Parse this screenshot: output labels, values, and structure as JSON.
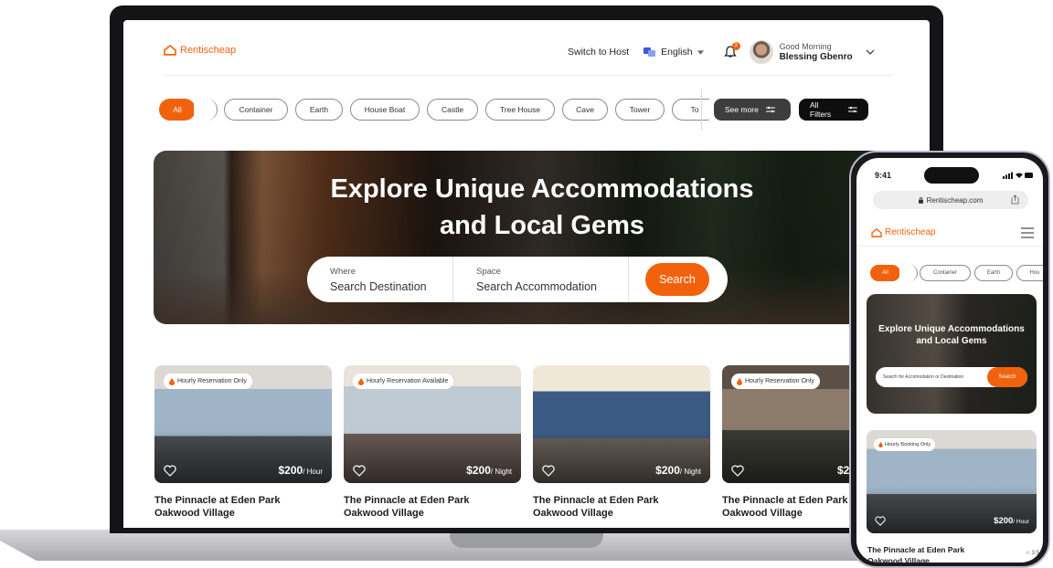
{
  "brand": {
    "name": "Rentischeap",
    "accent": "#f2620d"
  },
  "header": {
    "switch_host": "Switch to Host",
    "language": "English",
    "notification_count": "3",
    "greeting": "Good Morning",
    "user_name": "Blessing Gbenro"
  },
  "categories": [
    "All",
    "",
    "Container",
    "Earth",
    "House Boat",
    "Castle",
    "Tree House",
    "Cave",
    "Tower",
    "To"
  ],
  "filters": {
    "see_more": "See more",
    "all_filters": "All Filters"
  },
  "hero": {
    "title_line1": "Explore Unique Accommodations",
    "title_line2": "and Local Gems",
    "where_label": "Where",
    "where_placeholder": "Search Destination",
    "space_label": "Space",
    "space_placeholder": "Search Accommodation",
    "search_button": "Search"
  },
  "listings": [
    {
      "badge": "Hourly Reservation Only",
      "price": "$200",
      "unit": "/ Hour",
      "name_line1": "The Pinnacle at Eden Park",
      "name_line2": "Oakwood Village"
    },
    {
      "badge": "Hourly Reservation Available",
      "price": "$200",
      "unit": "/ Night",
      "name_line1": "The Pinnacle at Eden Park",
      "name_line2": "Oakwood Village"
    },
    {
      "badge": "",
      "price": "$200",
      "unit": "/ Night",
      "name_line1": "The Pinnacle at Eden Park",
      "name_line2": "Oakwood Village"
    },
    {
      "badge": "Hourly Reservation Only",
      "price": "$2",
      "unit": "",
      "name_line1": "The Pinnacle at Eden Park",
      "name_line2": "Oakwood Village"
    }
  ],
  "mobile": {
    "time": "9:41",
    "url": "Rentischeap.com",
    "brand": "Rentischeap",
    "chips": [
      "All",
      "",
      "Container",
      "Earth",
      "Hou"
    ],
    "hero_line1": "Explore Unique Accommodations",
    "hero_line2": "and Local Gems",
    "search_placeholder": "Search for Accomodation or Destination",
    "search_button": "Search",
    "card_badge": "Hourly Booking Only",
    "card_price": "$200",
    "card_unit": "/ Hour",
    "card_name_line1": "The Pinnacle at Eden Park",
    "card_name_line2": "Oakwood Village",
    "rating": "3.5"
  }
}
